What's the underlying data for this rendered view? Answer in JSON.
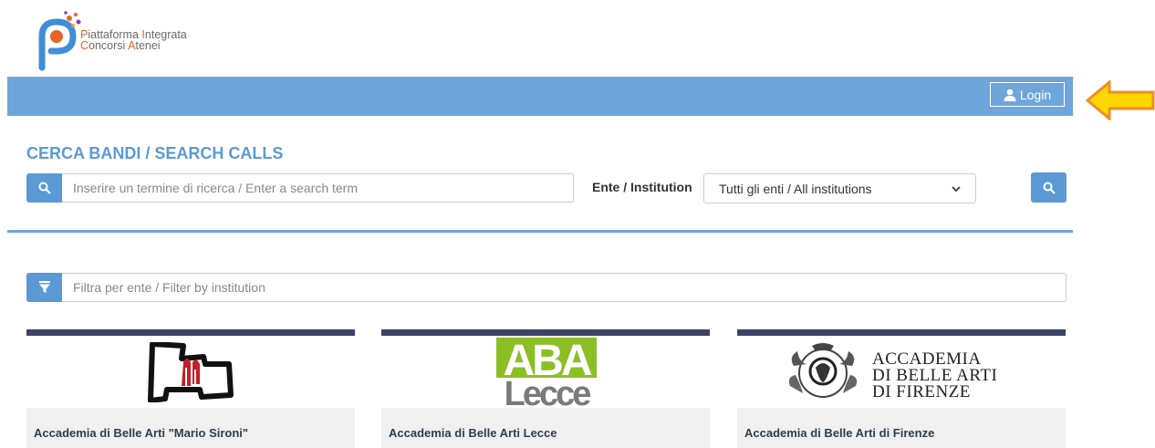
{
  "brand": {
    "line1_first": "P",
    "line1_mid": "iattaforma ",
    "line1_i": "I",
    "line1_rest": "ntegrata",
    "line2_first": "C",
    "line2_mid": "oncorsi ",
    "line2_a": "A",
    "line2_rest": "tenei"
  },
  "header": {
    "login_label": "Login"
  },
  "search": {
    "title": "CERCA BANDI / SEARCH CALLS",
    "placeholder": "Inserire un termine di ricerca / Enter a search term",
    "institution_label": "Ente / Institution",
    "institution_selected": "Tutti gli enti / All institutions"
  },
  "filter": {
    "placeholder": "Filtra per ente / Filter by institution"
  },
  "cards": [
    {
      "name": "Accademia di Belle Arti \"Mario Sironi\""
    },
    {
      "name": "Accademia di Belle Arti Lecce",
      "logo_top": "ABA",
      "logo_bottom": "Lecce"
    },
    {
      "name": "Accademia di Belle Arti di Firenze",
      "logo_lines": [
        "ACCADEMIA",
        "DI BELLE ARTI",
        "DI FIRENZE"
      ]
    }
  ],
  "colors": {
    "accent": "#5b9ad5",
    "topbar": "#6ea6db",
    "card_top": "#3a4368",
    "aba_green": "#8cbf26",
    "arrow": "#ffd700"
  },
  "icons": {
    "search": "search-icon",
    "filter": "filter-icon",
    "user": "user-icon",
    "chevron": "chevron-down-icon"
  }
}
